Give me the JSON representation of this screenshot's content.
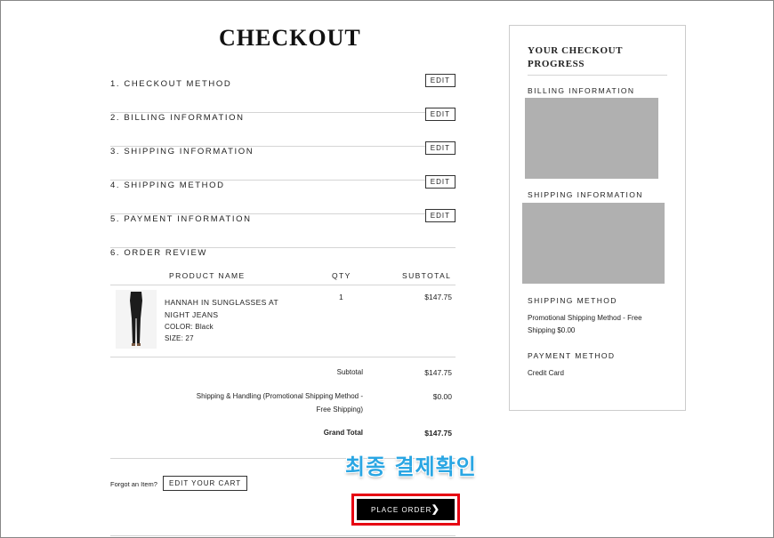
{
  "checkout": {
    "title": "CHECKOUT",
    "steps": [
      {
        "label": "1. CHECKOUT METHOD",
        "edit": "EDIT"
      },
      {
        "label": "2. BILLING INFORMATION",
        "edit": "EDIT"
      },
      {
        "label": "3. SHIPPING INFORMATION",
        "edit": "EDIT"
      },
      {
        "label": "4. SHIPPING METHOD",
        "edit": "EDIT"
      },
      {
        "label": "5. PAYMENT INFORMATION",
        "edit": "EDIT"
      }
    ],
    "review_label": "6. ORDER REVIEW"
  },
  "review": {
    "headers": {
      "product": "PRODUCT NAME",
      "qty": "QTY",
      "subtotal": "SUBTOTAL"
    },
    "item": {
      "name": "HANNAH IN SUNGLASSES AT NIGHT JEANS",
      "color": "COLOR: Black",
      "size": "SIZE: 27",
      "qty": "1",
      "subtotal": "$147.75"
    },
    "totals": {
      "subtotal_label": "Subtotal",
      "subtotal_value": "$147.75",
      "shipping_label": "Shipping & Handling (Promotional Shipping Method - Free Shipping)",
      "shipping_value": "$0.00",
      "grand_label": "Grand Total",
      "grand_value": "$147.75"
    }
  },
  "footer": {
    "forgot": "Forgot an Item?",
    "edit_cart": "EDIT YOUR CART",
    "place_order": "PLACE ORDER",
    "annotation": "최종 결제확인"
  },
  "progress": {
    "title": "YOUR CHECKOUT PROGRESS",
    "billing_label": "BILLING INFORMATION",
    "shipping_label": "SHIPPING INFORMATION",
    "shipping_method_label": "SHIPPING METHOD",
    "shipping_method_value": "Promotional Shipping Method - Free Shipping $0.00",
    "payment_method_label": "PAYMENT METHOD",
    "payment_method_value": "Credit Card"
  },
  "colors": {
    "highlight_border": "#e60012",
    "annotation_text": "#2aa6e3",
    "redacted": "#b0b0b0"
  }
}
